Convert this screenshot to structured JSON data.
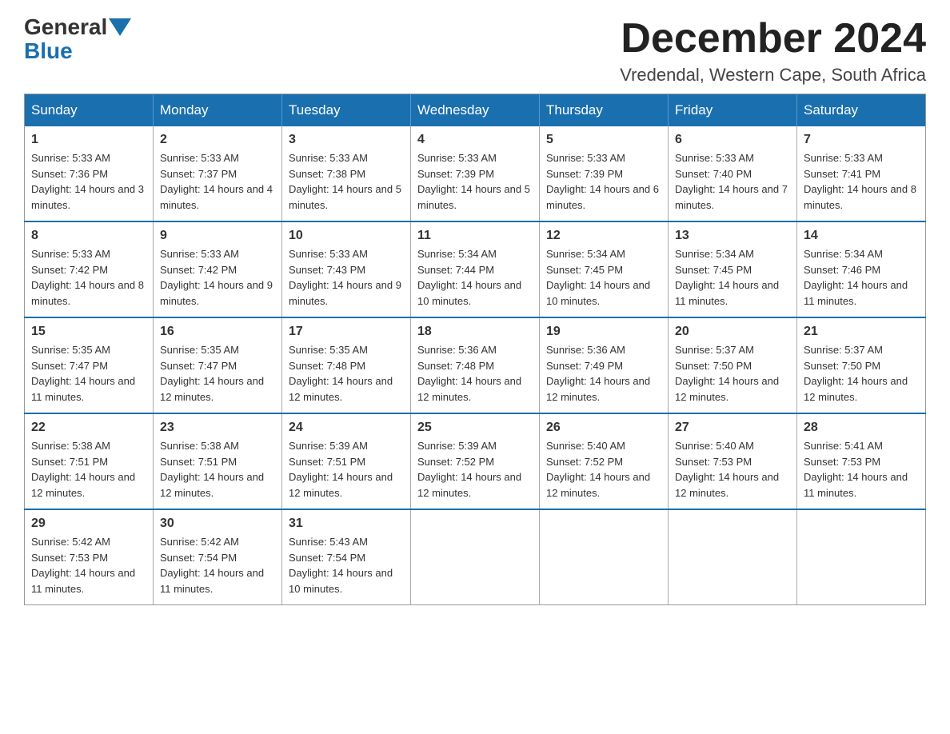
{
  "header": {
    "logo_general": "General",
    "logo_blue": "Blue",
    "month_title": "December 2024",
    "location": "Vredendal, Western Cape, South Africa"
  },
  "weekdays": [
    "Sunday",
    "Monday",
    "Tuesday",
    "Wednesday",
    "Thursday",
    "Friday",
    "Saturday"
  ],
  "weeks": [
    [
      {
        "day": "1",
        "sunrise": "5:33 AM",
        "sunset": "7:36 PM",
        "daylight": "14 hours and 3 minutes."
      },
      {
        "day": "2",
        "sunrise": "5:33 AM",
        "sunset": "7:37 PM",
        "daylight": "14 hours and 4 minutes."
      },
      {
        "day": "3",
        "sunrise": "5:33 AM",
        "sunset": "7:38 PM",
        "daylight": "14 hours and 5 minutes."
      },
      {
        "day": "4",
        "sunrise": "5:33 AM",
        "sunset": "7:39 PM",
        "daylight": "14 hours and 5 minutes."
      },
      {
        "day": "5",
        "sunrise": "5:33 AM",
        "sunset": "7:39 PM",
        "daylight": "14 hours and 6 minutes."
      },
      {
        "day": "6",
        "sunrise": "5:33 AM",
        "sunset": "7:40 PM",
        "daylight": "14 hours and 7 minutes."
      },
      {
        "day": "7",
        "sunrise": "5:33 AM",
        "sunset": "7:41 PM",
        "daylight": "14 hours and 8 minutes."
      }
    ],
    [
      {
        "day": "8",
        "sunrise": "5:33 AM",
        "sunset": "7:42 PM",
        "daylight": "14 hours and 8 minutes."
      },
      {
        "day": "9",
        "sunrise": "5:33 AM",
        "sunset": "7:42 PM",
        "daylight": "14 hours and 9 minutes."
      },
      {
        "day": "10",
        "sunrise": "5:33 AM",
        "sunset": "7:43 PM",
        "daylight": "14 hours and 9 minutes."
      },
      {
        "day": "11",
        "sunrise": "5:34 AM",
        "sunset": "7:44 PM",
        "daylight": "14 hours and 10 minutes."
      },
      {
        "day": "12",
        "sunrise": "5:34 AM",
        "sunset": "7:45 PM",
        "daylight": "14 hours and 10 minutes."
      },
      {
        "day": "13",
        "sunrise": "5:34 AM",
        "sunset": "7:45 PM",
        "daylight": "14 hours and 11 minutes."
      },
      {
        "day": "14",
        "sunrise": "5:34 AM",
        "sunset": "7:46 PM",
        "daylight": "14 hours and 11 minutes."
      }
    ],
    [
      {
        "day": "15",
        "sunrise": "5:35 AM",
        "sunset": "7:47 PM",
        "daylight": "14 hours and 11 minutes."
      },
      {
        "day": "16",
        "sunrise": "5:35 AM",
        "sunset": "7:47 PM",
        "daylight": "14 hours and 12 minutes."
      },
      {
        "day": "17",
        "sunrise": "5:35 AM",
        "sunset": "7:48 PM",
        "daylight": "14 hours and 12 minutes."
      },
      {
        "day": "18",
        "sunrise": "5:36 AM",
        "sunset": "7:48 PM",
        "daylight": "14 hours and 12 minutes."
      },
      {
        "day": "19",
        "sunrise": "5:36 AM",
        "sunset": "7:49 PM",
        "daylight": "14 hours and 12 minutes."
      },
      {
        "day": "20",
        "sunrise": "5:37 AM",
        "sunset": "7:50 PM",
        "daylight": "14 hours and 12 minutes."
      },
      {
        "day": "21",
        "sunrise": "5:37 AM",
        "sunset": "7:50 PM",
        "daylight": "14 hours and 12 minutes."
      }
    ],
    [
      {
        "day": "22",
        "sunrise": "5:38 AM",
        "sunset": "7:51 PM",
        "daylight": "14 hours and 12 minutes."
      },
      {
        "day": "23",
        "sunrise": "5:38 AM",
        "sunset": "7:51 PM",
        "daylight": "14 hours and 12 minutes."
      },
      {
        "day": "24",
        "sunrise": "5:39 AM",
        "sunset": "7:51 PM",
        "daylight": "14 hours and 12 minutes."
      },
      {
        "day": "25",
        "sunrise": "5:39 AM",
        "sunset": "7:52 PM",
        "daylight": "14 hours and 12 minutes."
      },
      {
        "day": "26",
        "sunrise": "5:40 AM",
        "sunset": "7:52 PM",
        "daylight": "14 hours and 12 minutes."
      },
      {
        "day": "27",
        "sunrise": "5:40 AM",
        "sunset": "7:53 PM",
        "daylight": "14 hours and 12 minutes."
      },
      {
        "day": "28",
        "sunrise": "5:41 AM",
        "sunset": "7:53 PM",
        "daylight": "14 hours and 11 minutes."
      }
    ],
    [
      {
        "day": "29",
        "sunrise": "5:42 AM",
        "sunset": "7:53 PM",
        "daylight": "14 hours and 11 minutes."
      },
      {
        "day": "30",
        "sunrise": "5:42 AM",
        "sunset": "7:54 PM",
        "daylight": "14 hours and 11 minutes."
      },
      {
        "day": "31",
        "sunrise": "5:43 AM",
        "sunset": "7:54 PM",
        "daylight": "14 hours and 10 minutes."
      },
      null,
      null,
      null,
      null
    ]
  ]
}
